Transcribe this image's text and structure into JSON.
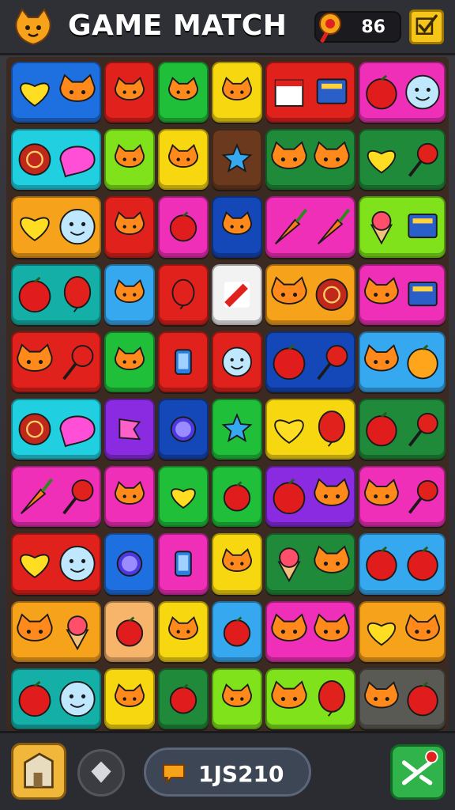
{
  "header": {
    "title": "GAME MATCH",
    "score": "86",
    "logo_icon": "cat-face-icon",
    "score_icon": "lollipop-icon",
    "confirm_icon": "checkmark-icon"
  },
  "footer": {
    "counter": "1JS210",
    "home_icon": "building-icon",
    "hint_icon": "diamond-icon",
    "counter_icon": "speech-bubble-icon",
    "shuffle_icon": "shuffle-icon"
  },
  "colors": {
    "blue": "#1e6fe0",
    "red": "#e0211c",
    "green": "#1fbf3a",
    "yellow": "#f6d710",
    "pink": "#ef2fb8",
    "cyan": "#20cfe0",
    "lime": "#7fe21b",
    "brown": "#6b3a1e",
    "orange": "#f6a21b",
    "teal": "#14b0a8",
    "purple": "#8a2be2",
    "navy": "#1447b8",
    "darkgreen": "#1f8a3a",
    "white": "#f2f2f2",
    "peach": "#f7b56b",
    "olive": "#7a8a3a",
    "skyblue": "#35a8f0",
    "gray": "#5a5a55"
  },
  "board": {
    "tiles": [
      {
        "row": 0,
        "col": 0,
        "span": 2,
        "color": "blue",
        "icons": [
          "heart-icon",
          "cat-face-icon"
        ]
      },
      {
        "row": 0,
        "col": 2,
        "span": 1,
        "color": "red",
        "icons": [
          "cat-face-icon"
        ]
      },
      {
        "row": 0,
        "col": 3,
        "span": 1,
        "color": "green",
        "icons": [
          "cat-face-icon"
        ]
      },
      {
        "row": 0,
        "col": 4,
        "span": 1,
        "color": "yellow",
        "icons": [
          "cat-face-icon"
        ]
      },
      {
        "row": 0,
        "col": 5,
        "span": 2,
        "color": "red",
        "icons": [
          "calendar-icon",
          "monitor-icon"
        ]
      },
      {
        "row": 0,
        "col": 7,
        "span": 2,
        "color": "pink",
        "icons": [
          "apple-icon",
          "smiley-icon"
        ]
      },
      {
        "row": 1,
        "col": 0,
        "span": 2,
        "color": "cyan",
        "icons": [
          "candy-icon",
          "speech-bubble-icon"
        ]
      },
      {
        "row": 1,
        "col": 2,
        "span": 1,
        "color": "lime",
        "icons": [
          "cat-face-icon"
        ]
      },
      {
        "row": 1,
        "col": 3,
        "span": 1,
        "color": "yellow",
        "icons": [
          "cat-face-icon"
        ]
      },
      {
        "row": 1,
        "col": 4,
        "span": 1,
        "color": "brown",
        "icons": [
          "star-icon"
        ]
      },
      {
        "row": 1,
        "col": 5,
        "span": 2,
        "color": "darkgreen",
        "icons": [
          "cat-face-icon",
          "cat-face-icon"
        ]
      },
      {
        "row": 1,
        "col": 7,
        "span": 2,
        "color": "darkgreen",
        "icons": [
          "heart-icon",
          "lollipop-icon"
        ]
      },
      {
        "row": 2,
        "col": 0,
        "span": 2,
        "color": "orange",
        "icons": [
          "heart-icon",
          "smiley-icon"
        ]
      },
      {
        "row": 2,
        "col": 2,
        "span": 1,
        "color": "red",
        "icons": [
          "cat-face-icon"
        ]
      },
      {
        "row": 2,
        "col": 3,
        "span": 1,
        "color": "pink",
        "icons": [
          "apple-icon"
        ]
      },
      {
        "row": 2,
        "col": 4,
        "span": 1,
        "color": "navy",
        "icons": [
          "cat-face-icon"
        ]
      },
      {
        "row": 2,
        "col": 5,
        "span": 2,
        "color": "pink",
        "icons": [
          "carrot-icon",
          "carrot-icon"
        ]
      },
      {
        "row": 2,
        "col": 7,
        "span": 2,
        "color": "lime",
        "icons": [
          "ice-cream-icon",
          "monitor-icon"
        ]
      },
      {
        "row": 3,
        "col": 0,
        "span": 2,
        "color": "teal",
        "icons": [
          "apple-icon",
          "balloon-icon"
        ]
      },
      {
        "row": 3,
        "col": 2,
        "span": 1,
        "color": "skyblue",
        "icons": [
          "cat-face-icon"
        ]
      },
      {
        "row": 3,
        "col": 3,
        "span": 1,
        "color": "red",
        "icons": [
          "balloon-icon"
        ]
      },
      {
        "row": 3,
        "col": 4,
        "span": 1,
        "color": "white",
        "icons": [
          "pencil-icon"
        ]
      },
      {
        "row": 3,
        "col": 5,
        "span": 2,
        "color": "orange",
        "icons": [
          "cat-face-icon",
          "candy-icon"
        ]
      },
      {
        "row": 3,
        "col": 7,
        "span": 2,
        "color": "pink",
        "icons": [
          "cat-face-icon",
          "monitor-icon"
        ]
      },
      {
        "row": 4,
        "col": 0,
        "span": 2,
        "color": "red",
        "icons": [
          "cat-face-icon",
          "lollipop-icon"
        ]
      },
      {
        "row": 4,
        "col": 2,
        "span": 1,
        "color": "green",
        "icons": [
          "cat-face-icon"
        ]
      },
      {
        "row": 4,
        "col": 3,
        "span": 1,
        "color": "red",
        "icons": [
          "phone-icon"
        ]
      },
      {
        "row": 4,
        "col": 4,
        "span": 1,
        "color": "red",
        "icons": [
          "smiley-icon"
        ]
      },
      {
        "row": 4,
        "col": 5,
        "span": 2,
        "color": "navy",
        "icons": [
          "apple-icon",
          "lollipop-icon"
        ]
      },
      {
        "row": 4,
        "col": 7,
        "span": 2,
        "color": "skyblue",
        "icons": [
          "cat-face-icon",
          "orange-icon"
        ]
      },
      {
        "row": 5,
        "col": 0,
        "span": 2,
        "color": "cyan",
        "icons": [
          "candy-icon",
          "speech-bubble-icon"
        ]
      },
      {
        "row": 5,
        "col": 2,
        "span": 1,
        "color": "purple",
        "icons": [
          "flag-icon"
        ]
      },
      {
        "row": 5,
        "col": 3,
        "span": 1,
        "color": "navy",
        "icons": [
          "orb-icon"
        ]
      },
      {
        "row": 5,
        "col": 4,
        "span": 1,
        "color": "green",
        "icons": [
          "star-icon"
        ]
      },
      {
        "row": 5,
        "col": 5,
        "span": 2,
        "color": "yellow",
        "icons": [
          "heart-icon",
          "balloon-icon"
        ]
      },
      {
        "row": 5,
        "col": 7,
        "span": 2,
        "color": "darkgreen",
        "icons": [
          "apple-icon",
          "lollipop-icon"
        ]
      },
      {
        "row": 6,
        "col": 0,
        "span": 2,
        "color": "pink",
        "icons": [
          "carrot-icon",
          "lollipop-icon"
        ]
      },
      {
        "row": 6,
        "col": 2,
        "span": 1,
        "color": "pink",
        "icons": [
          "cat-face-icon"
        ]
      },
      {
        "row": 6,
        "col": 3,
        "span": 1,
        "color": "green",
        "icons": [
          "heart-icon"
        ]
      },
      {
        "row": 6,
        "col": 4,
        "span": 1,
        "color": "green",
        "icons": [
          "apple-icon"
        ]
      },
      {
        "row": 6,
        "col": 5,
        "span": 2,
        "color": "purple",
        "icons": [
          "apple-icon",
          "cat-face-icon"
        ]
      },
      {
        "row": 6,
        "col": 7,
        "span": 2,
        "color": "pink",
        "icons": [
          "cat-face-icon",
          "lollipop-icon"
        ]
      },
      {
        "row": 7,
        "col": 0,
        "span": 2,
        "color": "red",
        "icons": [
          "heart-icon",
          "smiley-icon"
        ]
      },
      {
        "row": 7,
        "col": 2,
        "span": 1,
        "color": "blue",
        "icons": [
          "orb-icon"
        ]
      },
      {
        "row": 7,
        "col": 3,
        "span": 1,
        "color": "pink",
        "icons": [
          "phone-icon"
        ]
      },
      {
        "row": 7,
        "col": 4,
        "span": 1,
        "color": "yellow",
        "icons": [
          "cat-face-icon"
        ]
      },
      {
        "row": 7,
        "col": 5,
        "span": 2,
        "color": "darkgreen",
        "icons": [
          "ice-cream-icon",
          "cat-face-icon"
        ]
      },
      {
        "row": 7,
        "col": 7,
        "span": 2,
        "color": "skyblue",
        "icons": [
          "apple-icon",
          "apple-icon"
        ]
      },
      {
        "row": 8,
        "col": 0,
        "span": 2,
        "color": "orange",
        "icons": [
          "cat-face-icon",
          "ice-cream-icon"
        ]
      },
      {
        "row": 8,
        "col": 2,
        "span": 1,
        "color": "peach",
        "icons": [
          "apple-icon"
        ]
      },
      {
        "row": 8,
        "col": 3,
        "span": 1,
        "color": "yellow",
        "icons": [
          "cat-face-icon"
        ]
      },
      {
        "row": 8,
        "col": 4,
        "span": 1,
        "color": "skyblue",
        "icons": [
          "apple-icon"
        ]
      },
      {
        "row": 8,
        "col": 5,
        "span": 2,
        "color": "pink",
        "icons": [
          "cat-face-icon",
          "cat-face-icon"
        ]
      },
      {
        "row": 8,
        "col": 7,
        "span": 2,
        "color": "orange",
        "icons": [
          "heart-icon",
          "cat-face-icon"
        ]
      },
      {
        "row": 9,
        "col": 0,
        "span": 2,
        "color": "teal",
        "icons": [
          "apple-icon",
          "smiley-icon"
        ]
      },
      {
        "row": 9,
        "col": 2,
        "span": 1,
        "color": "yellow",
        "icons": [
          "cat-face-icon"
        ]
      },
      {
        "row": 9,
        "col": 3,
        "span": 1,
        "color": "darkgreen",
        "icons": [
          "apple-icon"
        ]
      },
      {
        "row": 9,
        "col": 4,
        "span": 1,
        "color": "lime",
        "icons": [
          "cat-face-icon"
        ]
      },
      {
        "row": 9,
        "col": 5,
        "span": 2,
        "color": "lime",
        "icons": [
          "cat-face-icon",
          "balloon-icon"
        ]
      },
      {
        "row": 9,
        "col": 7,
        "span": 2,
        "color": "gray",
        "icons": [
          "cat-face-icon",
          "apple-icon"
        ]
      }
    ]
  }
}
